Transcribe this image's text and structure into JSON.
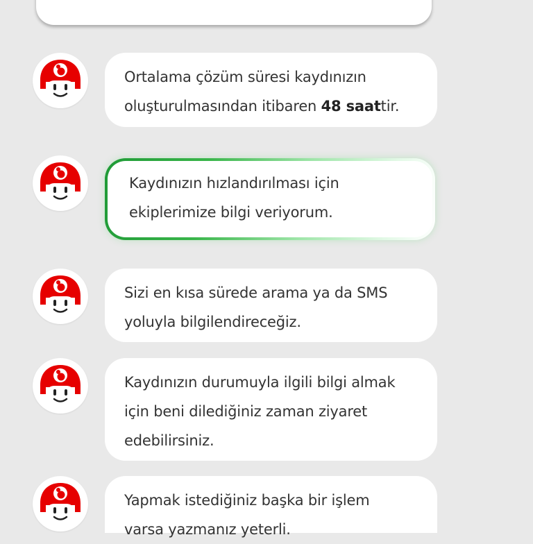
{
  "messages": [
    {
      "text_before": "Ortalama çözüm süresi kaydınızın\noluşturulmasından itibaren ",
      "bold": "48 saat",
      "text_after": "tir."
    },
    {
      "text": "Kaydınızın hızlandırılması için\nekiplerimize bilgi veriyorum."
    },
    {
      "text": "Sizi en kısa sürede arama ya da SMS\nyoluyla bilgilendireceğiz."
    },
    {
      "text": "Kaydınızın durumuyla ilgili bilgi almak\niçin beni dilediğiniz zaman ziyaret\nedebilirsiniz."
    },
    {
      "text": "Yapmak istediğiniz başka bir işlem\nvarsa yazmanız yeterli."
    }
  ],
  "colors": {
    "brand_red": "#e60000",
    "highlight_green": "#2aa83f",
    "background": "#e9e9e9"
  },
  "icons": {
    "avatar": "tobi-assistant-icon"
  }
}
